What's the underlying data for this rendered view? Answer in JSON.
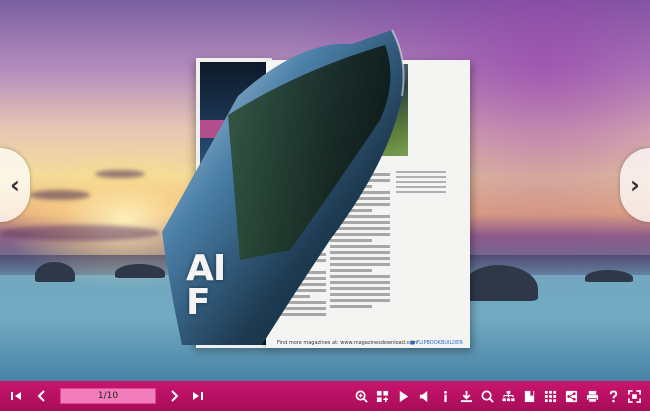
{
  "book": {
    "big_text": "AI\nF",
    "footer_note": "Find more magazines at: www.magazinesdownload.com",
    "footer_tag": "■ FLIPBOOKBUILDER"
  },
  "toolbar": {
    "page_indicator": "1/10",
    "icons": [
      "zoom-in-icon",
      "thumbnails-icon",
      "play-icon",
      "sound-icon",
      "info-icon",
      "download-icon",
      "search-icon",
      "tree-icon",
      "bookmark-icon",
      "grid-icon",
      "share-icon",
      "print-icon",
      "help-icon",
      "fullscreen-icon"
    ]
  },
  "nav": {
    "prev_glyph": "‹",
    "next_glyph": "›"
  },
  "colors": {
    "toolbar": "#b8105f",
    "page_box": "#f17ebb"
  }
}
